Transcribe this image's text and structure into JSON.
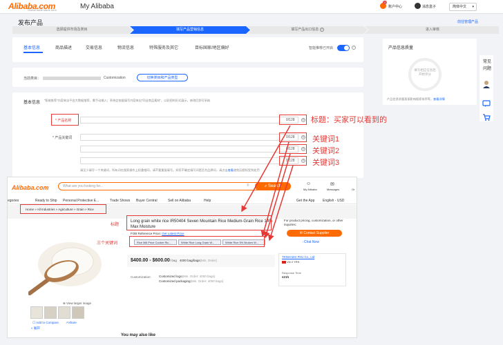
{
  "topbar": {
    "logo": "Alibaba.com",
    "logo_tagline": "Global trade starts here.",
    "title": "My Alibaba",
    "account_label": "账户中心",
    "account_badge": "17",
    "messages_label": "消息盒子",
    "language": "简体中文"
  },
  "page": {
    "title": "发布产品",
    "manage_link": "前往管理产品"
  },
  "steps": [
    "选择提供市场及类目",
    "填写产品营销信息",
    "填写产品出口信息",
    "进入审核"
  ],
  "tabs": [
    "基本信息",
    "商品描述",
    "交易信息",
    "物流信息",
    "特殊服务及其它",
    "目标国家/地区偏好"
  ],
  "smart_toggle_label": "智能推荐已开启",
  "category": {
    "label": "当前类目：",
    "value": "Customization",
    "change_button": "切换类目和产品类型"
  },
  "basic_info": {
    "heading": "基本信息",
    "notice": "“智能推荐”内容来自平台大数据推荐，需手动输入；系统会依据填写内容来自“同业商品素材”，以彩图的形式展示，修改后即可采纳",
    "product_name_label": "* 产品名称",
    "product_name_count": "0/128",
    "keyword_label": "* 产品关键词",
    "keyword_counts": [
      "0/128",
      "0/128",
      "0/128"
    ],
    "keyword_hint": "请至少填写一个关键词，所有词在搜索操作上权重相同，请不要重复填写。如您不确定填写词是否为品牌词，请点击",
    "keyword_hint_link": "查看",
    "keyword_hint_tail": "避免因侵权受到处罚"
  },
  "quality": {
    "title": "产品信息质量",
    "placeholder": "填写相应信息后开始评分",
    "desc": "产品信息质量直接影响搜索排序等，",
    "link": "查看详情"
  },
  "right_sidebar": {
    "label1": "常见",
    "label2": "问题"
  },
  "annotations": {
    "title_note": "标题：买家可以看到的",
    "kw1": "关键词1",
    "kw2": "关键词2",
    "kw3": "关键词3",
    "preview_title_note": "标题",
    "preview_kw_note": "三个关键词"
  },
  "preview": {
    "logo": "Alibaba.com",
    "search_placeholder": "What are you looking for...",
    "search_button": "Search",
    "my_alibaba": "My Alibaba",
    "messages": "Messages",
    "orders": "Or",
    "nav": [
      "egories",
      "Ready to Ship",
      "Personal Protective E...",
      "Trade Shows",
      "Buyer Central",
      "Sell on Alibaba",
      "Help"
    ],
    "get_app": "Get the App",
    "lang_currency": "English - USD",
    "breadcrumb": "Home » All Industries » Agriculture » Grain » Rice",
    "product_title": "Long grain white rice IR50404 Seven Mountain Rice Medium-Grain Rice 14% Max Moisture",
    "fob_label": "FOB Reference Price:",
    "fob_link": "Get Latest Price",
    "keyword_tags": [
      "Rice Mill Price Cooker Ric...",
      "White Rice Long Grain W...",
      "White Rice 5% Broken W..."
    ],
    "price": "$400.00 - $600.00",
    "price_unit": "/ bag",
    "min_order": "4000 bag/bags",
    "min_order_note": "(Min. Order)",
    "customization_label": "Customization:",
    "custom_logo": "Customized logo",
    "custom_logo_note": "(Min. Order: 4000 bags)",
    "custom_pack": "Customized packaging",
    "custom_pack_note": "(Min. Order: 4000 bags)",
    "inquiry_text": "For product pricing, customization, or other inquiries:",
    "contact_button": "Contact Supplier",
    "chat": "Chat Now",
    "supplier_name": "TRINH MAI PHU Co., Ltd",
    "supplier_country": "VN",
    "supplier_years": "2 YRS",
    "response_label": "Response Time",
    "response_value": "≤21h",
    "view_larger": "View larger image",
    "add_compare": "Add to Compare",
    "share": "Share",
    "may_like": "You may also like",
    "expand": "展开"
  },
  "colors": {
    "brand_orange": "#ff6a00",
    "primary_blue": "#1a66ff",
    "annotation_red": "#e53935"
  }
}
